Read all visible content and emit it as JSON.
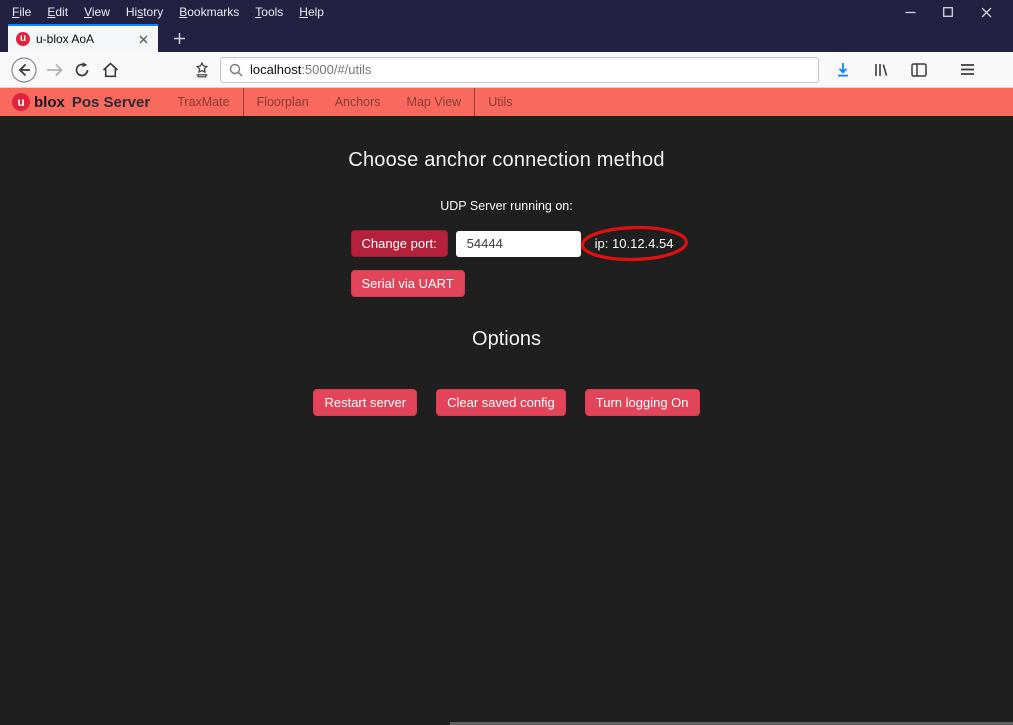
{
  "menubar": {
    "items": [
      {
        "label": "File",
        "u": 0
      },
      {
        "label": "Edit",
        "u": 0
      },
      {
        "label": "View",
        "u": 0
      },
      {
        "label": "History",
        "u": 2
      },
      {
        "label": "Bookmarks",
        "u": 0
      },
      {
        "label": "Tools",
        "u": 0
      },
      {
        "label": "Help",
        "u": 0
      }
    ]
  },
  "tabbar": {
    "active_tab": {
      "title": "u-blox AoA",
      "favicon_letter": "u"
    }
  },
  "toolbar": {
    "url": {
      "host": "localhost",
      "path": ":5000/#/utils"
    }
  },
  "site": {
    "navbar": {
      "brand": {
        "logo_letter": "u",
        "name": "blox",
        "suffix": "Pos Server"
      },
      "links": [
        "TraxMate",
        "Floorplan",
        "Anchors",
        "Map View",
        "Utils"
      ]
    },
    "main": {
      "heading": "Choose anchor connection method",
      "udp_status": "UDP Server running on:",
      "change_port_button": "Change port:",
      "port_value": "54444",
      "ip_label": "ip: 10.12.4.54",
      "serial_button": "Serial via UART",
      "options_heading": "Options",
      "option_buttons": [
        "Restart server",
        "Clear saved config",
        "Turn logging On"
      ]
    }
  },
  "colors": {
    "titlebar_bg": "#222142",
    "site_navbar_bg": "#f9695e",
    "brand_red": "#e0243c",
    "button_red": "#e2455a",
    "button_dark_red": "#b5213a",
    "accent_blue": "#0a84ff",
    "annotation_red": "#e01010",
    "content_bg": "#1f1f1f",
    "download_blue": "#0a84ff"
  }
}
